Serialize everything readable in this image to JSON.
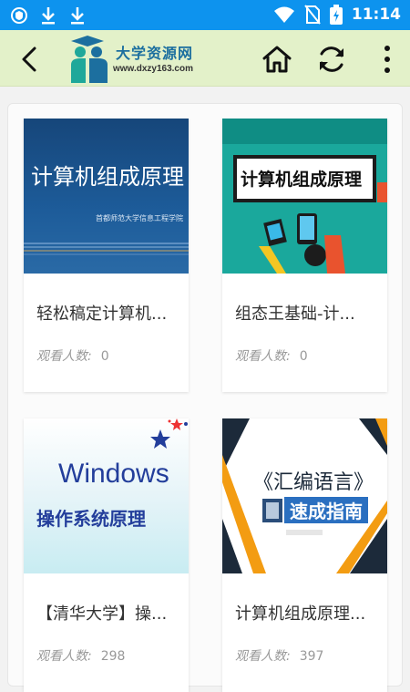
{
  "status_bar": {
    "time": "11:14",
    "icons": [
      "shield-icon",
      "download-icon",
      "download-icon",
      "wifi-icon",
      "no-sim-icon",
      "battery-charging-icon"
    ]
  },
  "toolbar": {
    "logo_title": "大学资源网",
    "logo_url": "www.dxzy163.com",
    "icons": [
      "back-arrow-icon",
      "home-icon",
      "refresh-icon",
      "more-vertical-icon"
    ]
  },
  "courses": [
    {
      "title": "轻松稿定计算机...",
      "views_label": "观看人数:",
      "views": "0",
      "thumb_text": "计算机组成原理",
      "thumb_subtext": "首都师范大学信息工程学院"
    },
    {
      "title": "组态王基础-计...",
      "views_label": "观看人数:",
      "views": "0",
      "thumb_text": "计算机组成原理"
    },
    {
      "title": "【清华大学】操...",
      "views_label": "观看人数:",
      "views": "298",
      "thumb_text": "Windows",
      "thumb_subtext": "操作系统原理"
    },
    {
      "title": "计算机组成原理...",
      "views_label": "观看人数:",
      "views": "397",
      "thumb_text": "《汇编语言》",
      "thumb_subtext": "速成指南"
    }
  ],
  "colors": {
    "status_bar": "#0d93ee",
    "toolbar": "#e3f1c9",
    "logo_blue": "#1c6f9f"
  }
}
